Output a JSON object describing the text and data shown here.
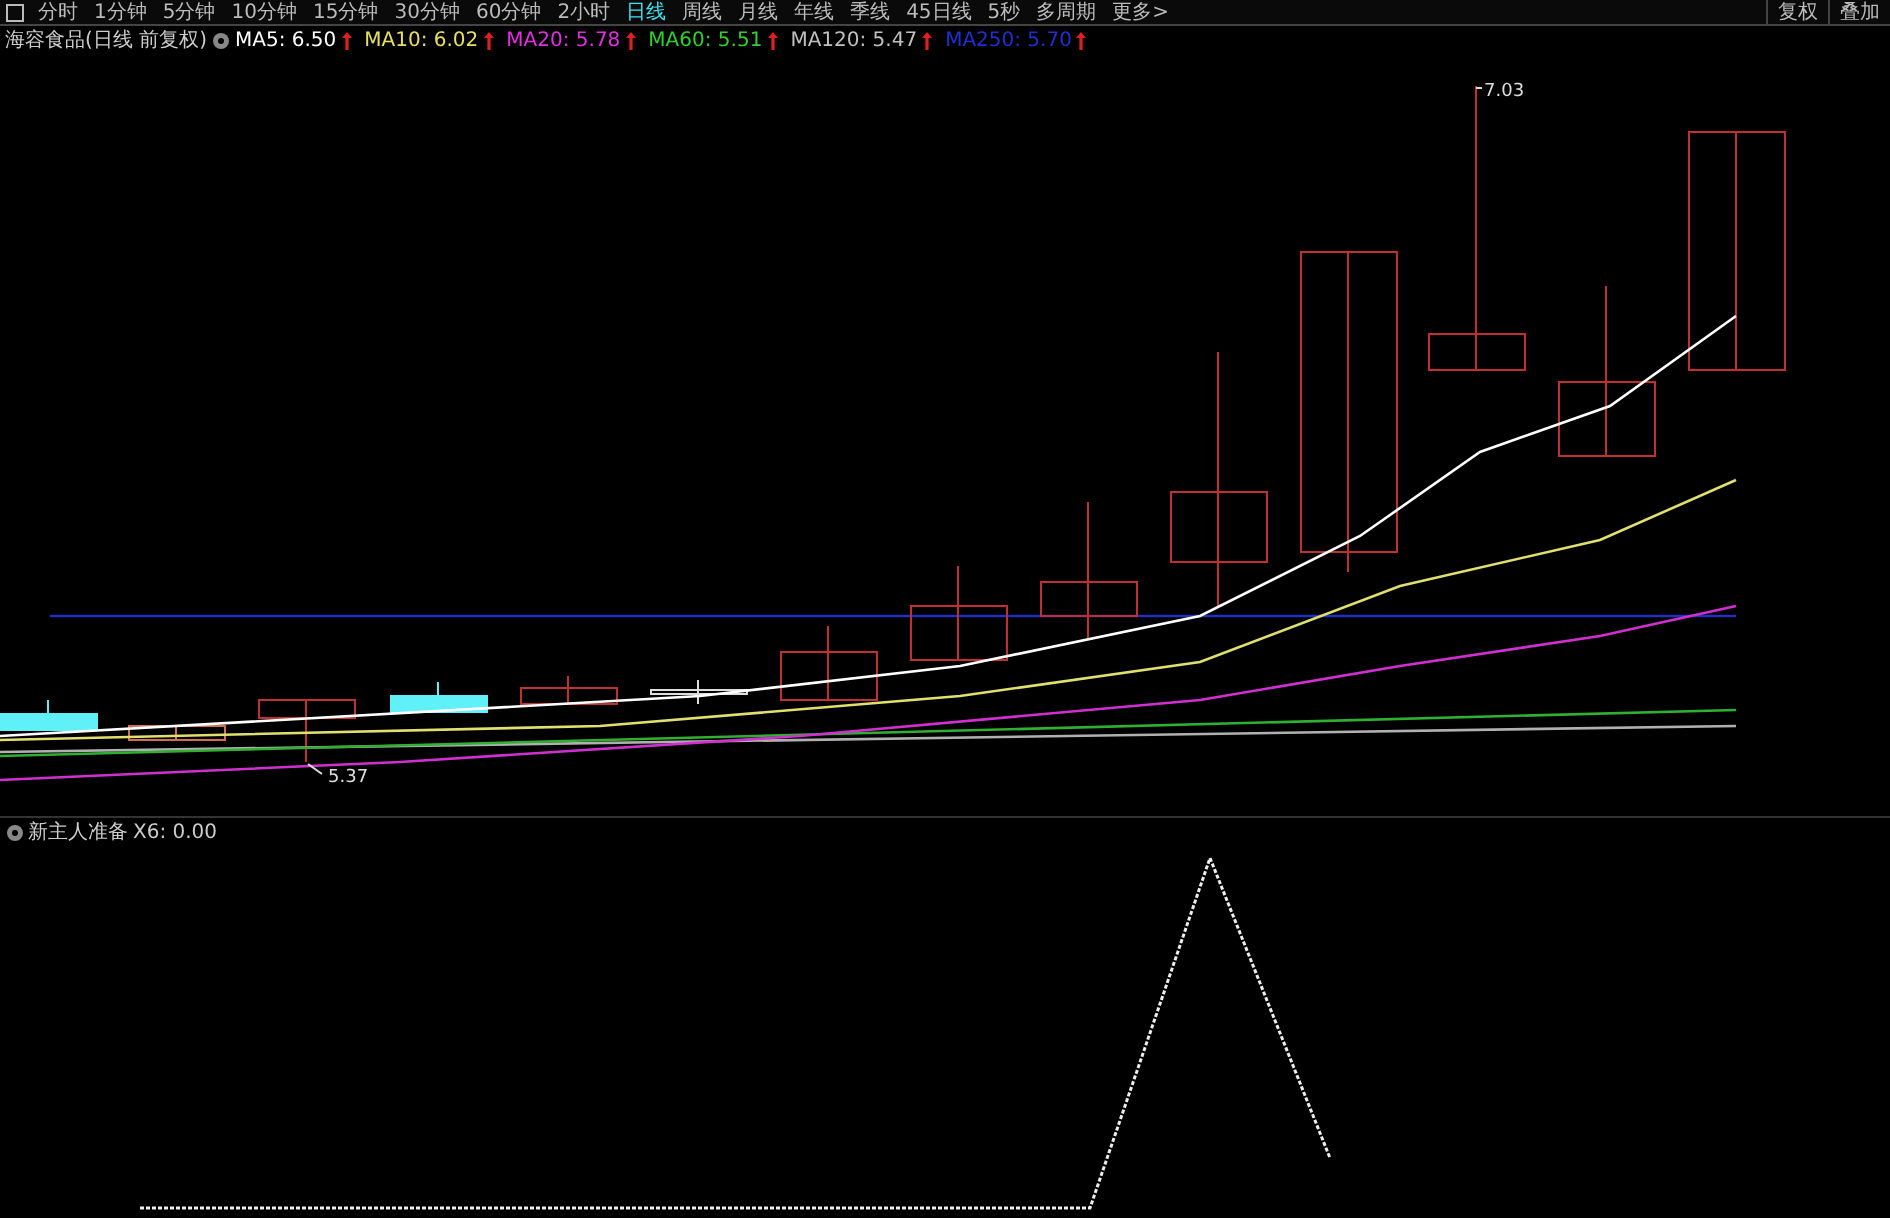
{
  "toolbar": {
    "tabs": [
      {
        "label": "分时",
        "selected": false
      },
      {
        "label": "1分钟",
        "selected": false
      },
      {
        "label": "5分钟",
        "selected": false
      },
      {
        "label": "10分钟",
        "selected": false
      },
      {
        "label": "15分钟",
        "selected": false
      },
      {
        "label": "30分钟",
        "selected": false
      },
      {
        "label": "60分钟",
        "selected": false
      },
      {
        "label": "2小时",
        "selected": false
      },
      {
        "label": "日线",
        "selected": true
      },
      {
        "label": "周线",
        "selected": false
      },
      {
        "label": "月线",
        "selected": false
      },
      {
        "label": "年线",
        "selected": false
      },
      {
        "label": "季线",
        "selected": false
      },
      {
        "label": "45日线",
        "selected": false
      },
      {
        "label": "5秒",
        "selected": false
      },
      {
        "label": "多周期",
        "selected": false
      },
      {
        "label": "更多>",
        "selected": false
      }
    ],
    "right_buttons": [
      "复权",
      "叠加"
    ]
  },
  "price_chart": {
    "title": "海容食品(日线 前复权)",
    "moving_averages": [
      {
        "label": "MA5:",
        "value": "6.50",
        "color": "#ffffff"
      },
      {
        "label": "MA10:",
        "value": "6.02",
        "color": "#e8e060"
      },
      {
        "label": "MA20:",
        "value": "5.78",
        "color": "#e030e0"
      },
      {
        "label": "MA60:",
        "value": "5.51",
        "color": "#30d030"
      },
      {
        "label": "MA120:",
        "value": "5.47",
        "color": "#c0c0c0"
      },
      {
        "label": "MA250:",
        "value": "5.70",
        "color": "#2030d0"
      }
    ],
    "high_label": "7.03",
    "low_label": "5.37"
  },
  "indicator": {
    "title": "新主人准备",
    "reading": "X6: 0.00"
  }
}
